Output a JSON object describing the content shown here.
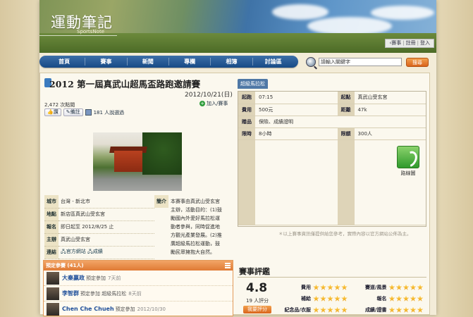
{
  "header": {
    "logo_cn": "運動筆記",
    "logo_en": "SportsNote",
    "links": [
      "賽事",
      "註冊",
      "登入"
    ]
  },
  "nav": {
    "items": [
      "首頁",
      "賽事",
      "新聞",
      "專欄",
      "相簿",
      "討論區"
    ]
  },
  "search": {
    "placeholder": "請輸入關鍵字",
    "button": "搜尋"
  },
  "event": {
    "title": "2012 第一屆真武山超馬盃路跑邀請賽",
    "date": "2012/10/21(日)",
    "add_to_trip": "加入",
    "trip_label": "賽事",
    "views": "2,472 次點閱",
    "btn_like": "讚",
    "btn_remind": "備註",
    "attending": "181 人說選過"
  },
  "info": {
    "city_k": "城市",
    "city_v": "台灣 - 新北市",
    "place_k": "地點",
    "place_v": "新店區真武山受玄宮",
    "signup_k": "報名",
    "signup_v": "即日起至 2012/8/25 止",
    "org_k": "主辦",
    "org_v": "真武山受玄宮",
    "link_k": "連結",
    "link_official": "官方網站",
    "link_results": "成績",
    "intro_k": "簡介",
    "intro_text": "本賽事由真武山受玄宮主辦，活動目的：(1)鼓勵國內外愛好馬拉松運動者參與，同時促進地方觀光產業發展。(2)推廣超級馬拉松運動，鼓勵民眾擁抱大自然。"
  },
  "race": {
    "tab": "超級馬拉松",
    "rows": [
      {
        "k1": "起跑",
        "v1": "07:15",
        "k2": "起點",
        "v2": "真武山受玄宮"
      },
      {
        "k1": "費用",
        "v1": "500元",
        "k2": "距離",
        "v2": "47k"
      },
      {
        "k1": "贈品",
        "v1": "保險、成績證明",
        "k2": "",
        "v2": ""
      },
      {
        "k1": "限時",
        "v1": "8小時",
        "k2": "限額",
        "v2": "300人"
      }
    ],
    "route_label": "路線圖",
    "note": "＊以上賽事資訊僅提供給您參考，實際內容以官方網站公佈為主。"
  },
  "registration": {
    "header": "預定參賽 (41人)",
    "items": [
      {
        "name": "大秦贏政",
        "action": "預定參加",
        "event": "",
        "time": "7天前"
      },
      {
        "name": "李智群",
        "action": "預定參加",
        "event": "超級馬拉松",
        "time": "8天前"
      },
      {
        "name": "Chen Che Chueh",
        "action": "預定參加",
        "event": "",
        "time": "2012/10/30"
      }
    ]
  },
  "rating": {
    "heading": "賽事評鑑",
    "score": "4.8",
    "count": "19 人評分",
    "button": "我要評分",
    "items": [
      {
        "label": "費用",
        "stars": 5
      },
      {
        "label": "賽道/風景",
        "stars": 5
      },
      {
        "label": "補給",
        "stars": 5
      },
      {
        "label": "報名",
        "stars": 5
      },
      {
        "label": "紀念品/衣服",
        "stars": 5
      },
      {
        "label": "成績/證書",
        "stars": 5
      }
    ]
  }
}
